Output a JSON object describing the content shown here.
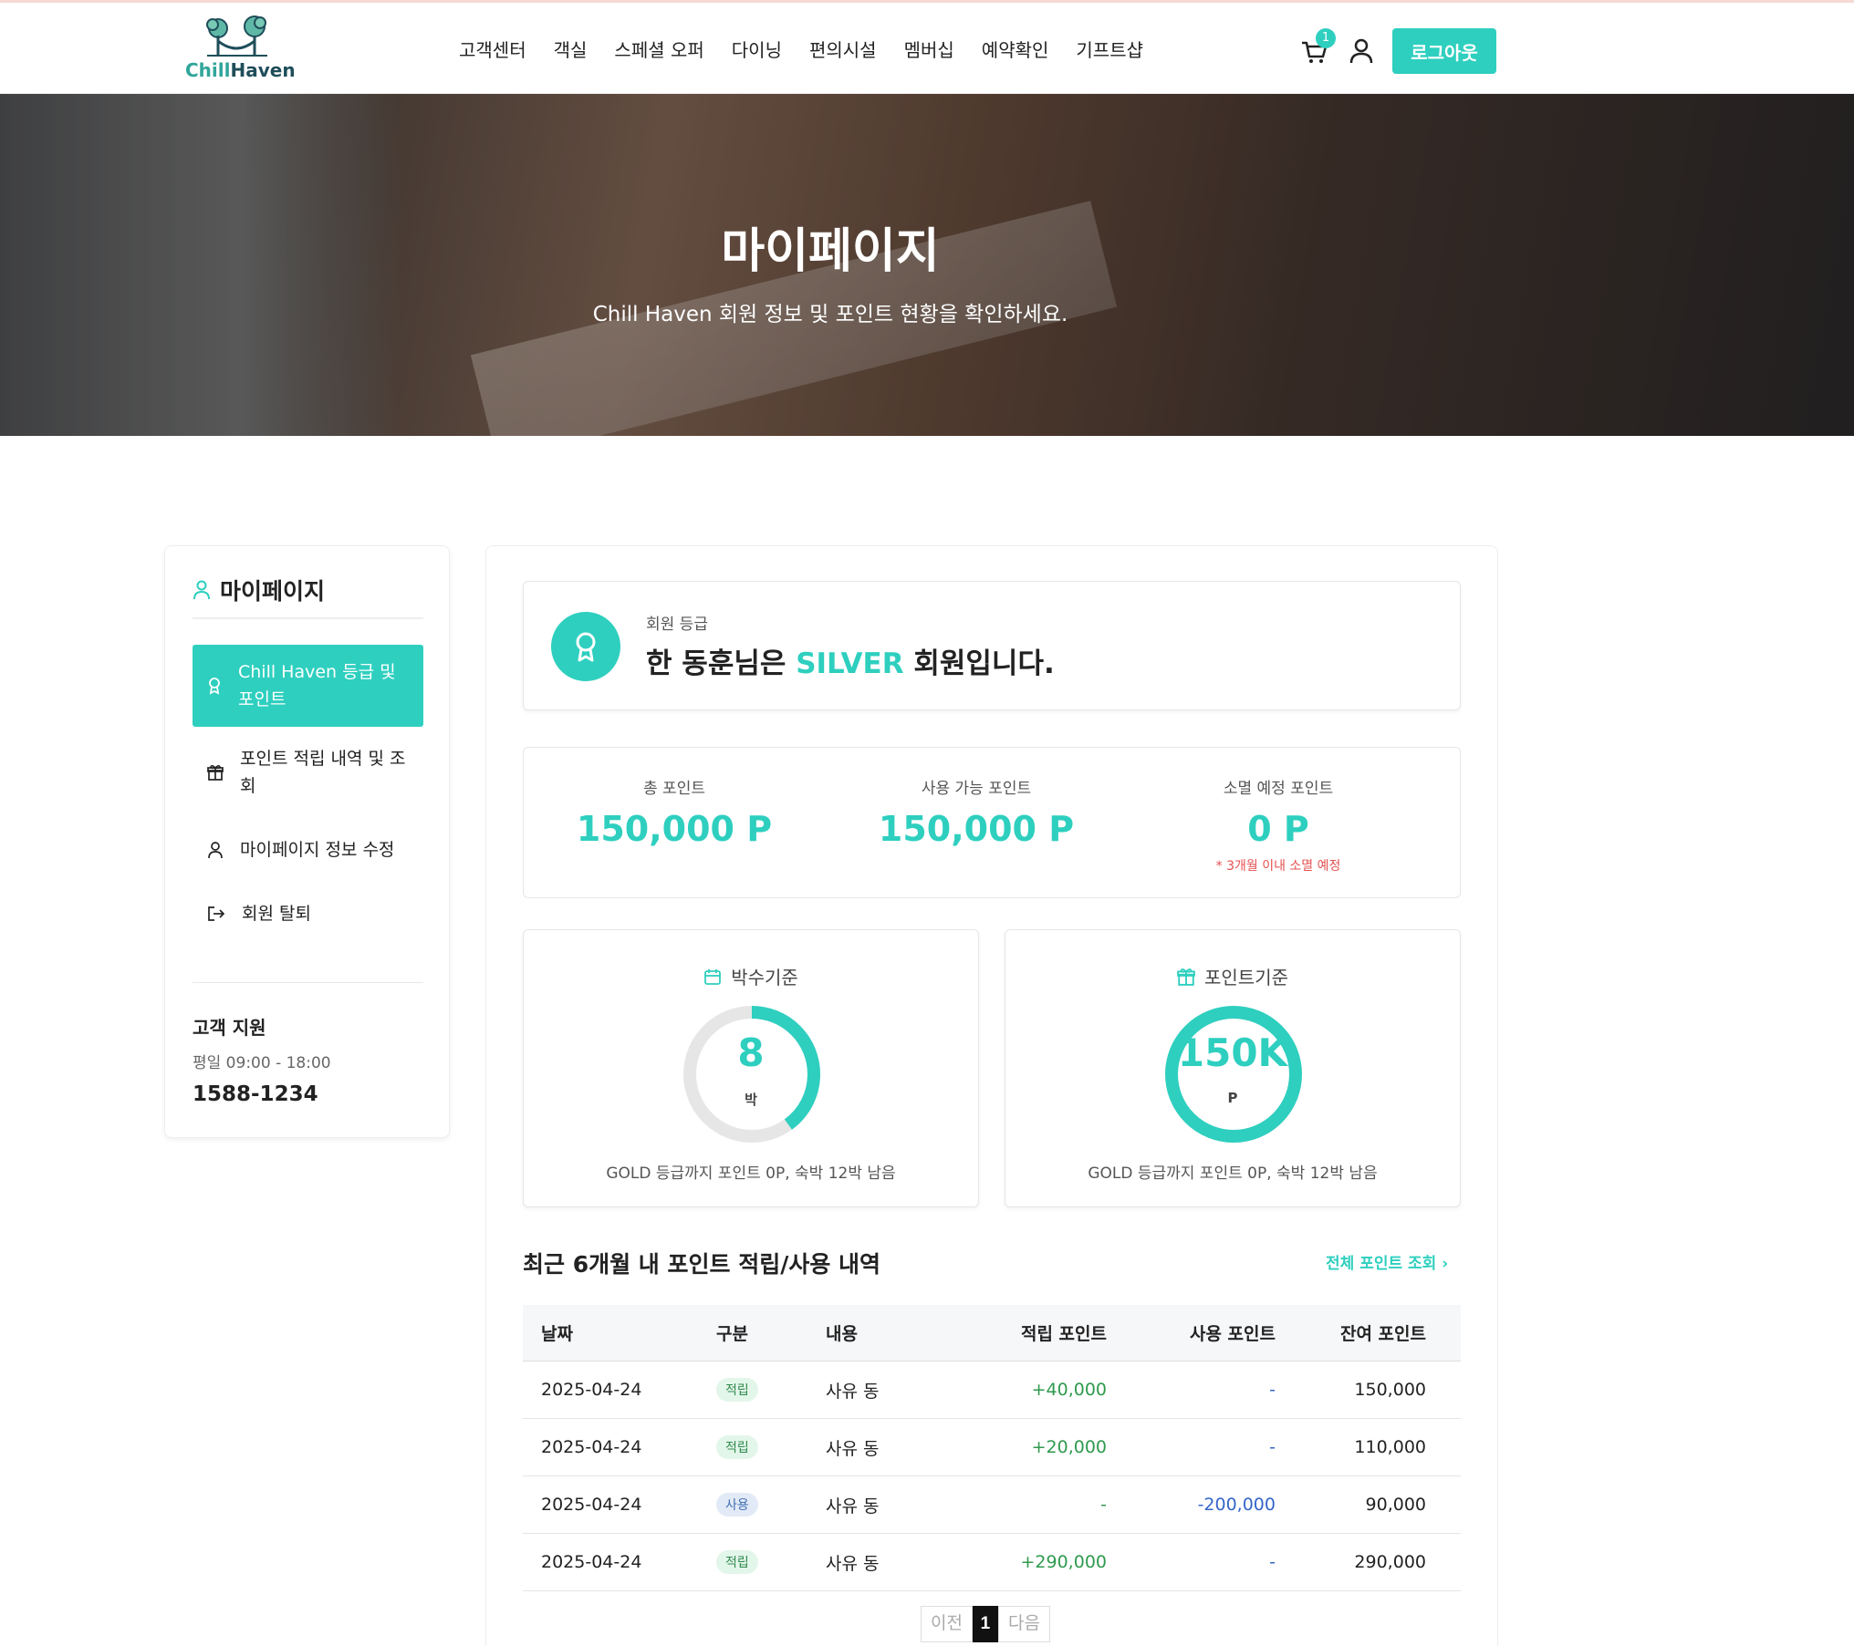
{
  "header": {
    "logo_chill": "Chill",
    "logo_haven": "Haven",
    "nav": [
      "고객센터",
      "객실",
      "스페셜 오퍼",
      "다이닝",
      "편의시설",
      "멤버십",
      "예약확인",
      "기프트샵"
    ],
    "cart_count": "1",
    "logout_label": "로그아웃"
  },
  "hero": {
    "title": "마이페이지",
    "subtitle": "Chill Haven 회원 정보 및 포인트 현황을 확인하세요."
  },
  "sidebar": {
    "title": "마이페이지",
    "items": [
      {
        "label": "Chill Haven 등급 및 포인트",
        "icon": "award-icon"
      },
      {
        "label": "포인트 적립 내역 및 조회",
        "icon": "gift-icon"
      },
      {
        "label": "마이페이지 정보 수정",
        "icon": "user-icon"
      },
      {
        "label": "회원 탈퇴",
        "icon": "logout-icon"
      }
    ],
    "support_title": "고객 지원",
    "support_hours": "평일 09:00 - 18:00",
    "support_phone": "1588-1234"
  },
  "grade": {
    "label": "회원 등급",
    "prefix": "한 동훈님은 ",
    "tier": "SILVER",
    "suffix": " 회원입니다."
  },
  "points": {
    "total_label": "총 포인트",
    "total_value": "150,000 P",
    "available_label": "사용 가능 포인트",
    "available_value": "150,000 P",
    "expiring_label": "소멸 예정 포인트",
    "expiring_value": "0 P",
    "expiring_note": "* 3개월 이내 소멸 예정"
  },
  "nights_ring": {
    "title": "박수기준",
    "value": "8",
    "unit": "박",
    "progress": 0.4,
    "footer": "GOLD 등급까지 포인트 0P, 숙박 12박 남음"
  },
  "points_ring": {
    "title": "포인트기준",
    "value": "150K",
    "unit": "P",
    "progress": 1.0,
    "footer": "GOLD 등급까지 포인트 0P, 숙박 12박 남음"
  },
  "history": {
    "title": "최근 6개월 내 포인트 적립/사용 내역",
    "link": "전체 포인트 조회",
    "headers": [
      "날짜",
      "구분",
      "내용",
      "적립 포인트",
      "사용 포인트",
      "잔여 포인트"
    ],
    "rows": [
      {
        "date": "2025-04-24",
        "type": "적립",
        "desc": "사유 동",
        "earn": "+40,000",
        "use": "-",
        "balance": "150,000"
      },
      {
        "date": "2025-04-24",
        "type": "적립",
        "desc": "사유 동",
        "earn": "+20,000",
        "use": "-",
        "balance": "110,000"
      },
      {
        "date": "2025-04-24",
        "type": "사용",
        "desc": "사유 동",
        "earn": "-",
        "use": "-200,000",
        "balance": "90,000"
      },
      {
        "date": "2025-04-24",
        "type": "적립",
        "desc": "사유 동",
        "earn": "+290,000",
        "use": "-",
        "balance": "290,000"
      }
    ]
  },
  "pager": {
    "prev": "이전",
    "current": "1",
    "next": "다음"
  },
  "colors": {
    "accent": "#2ecfbf",
    "earn_text": "#2f9a4e",
    "use_text": "#3466c9",
    "warn": "#e55050"
  }
}
